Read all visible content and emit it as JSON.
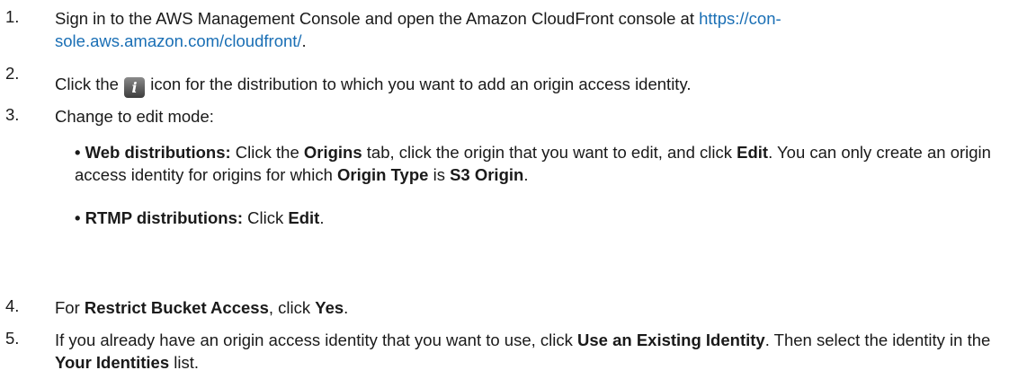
{
  "steps": [
    {
      "num": "1.",
      "text_pre": "Sign in to the AWS Management Console and open the Amazon CloudFront console at ",
      "link": "https://con-sole.aws.amazon.com/cloudfront/",
      "link_line1": "https://con-",
      "link_line2": "sole.aws.amazon.com/cloudfront/",
      "text_post": "."
    },
    {
      "num": "2.",
      "text_pre": "Click the ",
      "icon": "info-icon",
      "icon_glyph": "i",
      "text_post": " icon for the distribution to which you want to add an origin access identity."
    },
    {
      "num": "3.",
      "text": "Change to edit mode:",
      "bullets": [
        {
          "bold_lead": "Web distributions:",
          "t1": " Click the ",
          "b1": "Origins",
          "t2": " tab, click the origin that you want to edit, and click ",
          "b2": "Edit",
          "t3": ". You can only create an origin access identity for origins for which ",
          "b3": "Origin Type",
          "t4": " is ",
          "b4": "S3 Origin",
          "t5": "."
        },
        {
          "bold_lead": "RTMP distributions:",
          "t1": " Click ",
          "b1": "Edit",
          "t2": "."
        }
      ]
    },
    {
      "num": "4.",
      "t1": "For ",
      "b1": "Restrict Bucket Access",
      "t2": ", click ",
      "b2": "Yes",
      "t3": "."
    },
    {
      "num": "5.",
      "t1": "If you already have an origin access identity that you want to use, click ",
      "b1": "Use an Existing Identity",
      "t2": ". Then select the identity in the ",
      "b2": "Your Identities",
      "t3": " list."
    }
  ],
  "colors": {
    "text": "#1a1a1a",
    "link": "#1a6fb5"
  }
}
